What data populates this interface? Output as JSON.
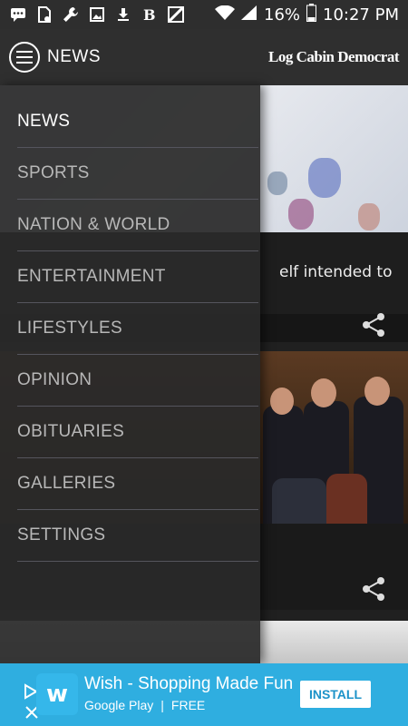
{
  "status_bar": {
    "battery": "16%",
    "time": "10:27 PM",
    "icons": [
      "message-icon",
      "sim-icon",
      "wrench-icon",
      "image-icon",
      "download-icon",
      "newspaper-icon",
      "flipboard-icon",
      "wifi-icon",
      "signal-icon",
      "battery-icon"
    ]
  },
  "header": {
    "section_title": "NEWS",
    "brand": "Log Cabin Democrat",
    "menu_icon": "menu-icon"
  },
  "drawer": {
    "items": [
      {
        "label": "NEWS",
        "active": true
      },
      {
        "label": "SPORTS",
        "active": false
      },
      {
        "label": "NATION & WORLD",
        "active": false
      },
      {
        "label": "ENTERTAINMENT",
        "active": false
      },
      {
        "label": "LIFESTYLES",
        "active": false
      },
      {
        "label": "OPINION",
        "active": false
      },
      {
        "label": "OBITUARIES",
        "active": false
      },
      {
        "label": "GALLERIES",
        "active": false
      },
      {
        "label": "SETTINGS",
        "active": false
      }
    ]
  },
  "feed": {
    "card1_title_fragment": "elf intended to"
  },
  "ad": {
    "title": "Wish - Shopping Made Fun",
    "store": "Google Play",
    "separator": "|",
    "price": "FREE",
    "install": "INSTALL",
    "icon_letter": "w"
  },
  "colors": {
    "ad_background": "#2faee0",
    "appbar": "#2f2f2f",
    "drawer": "#2a2a2a"
  }
}
